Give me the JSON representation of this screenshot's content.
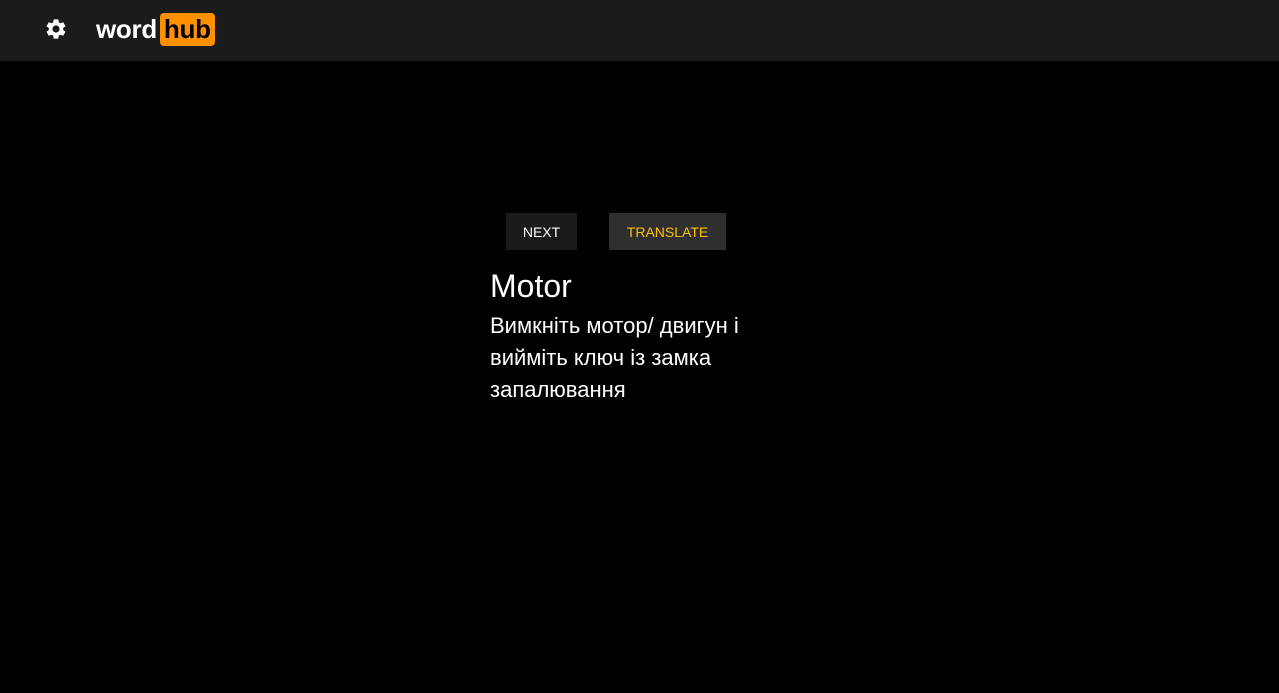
{
  "header": {
    "settings_icon": "gear-icon",
    "logo": {
      "part1": "word",
      "part2": "hub",
      "accent_color": "#ff9000"
    }
  },
  "main": {
    "buttons": {
      "next_label": "NEXT",
      "translate_label": "TRANSLATE"
    },
    "card": {
      "word": "Motor",
      "translation": "Вимкніть мотор/ двигун і вийміть ключ із замка запалювання"
    }
  }
}
